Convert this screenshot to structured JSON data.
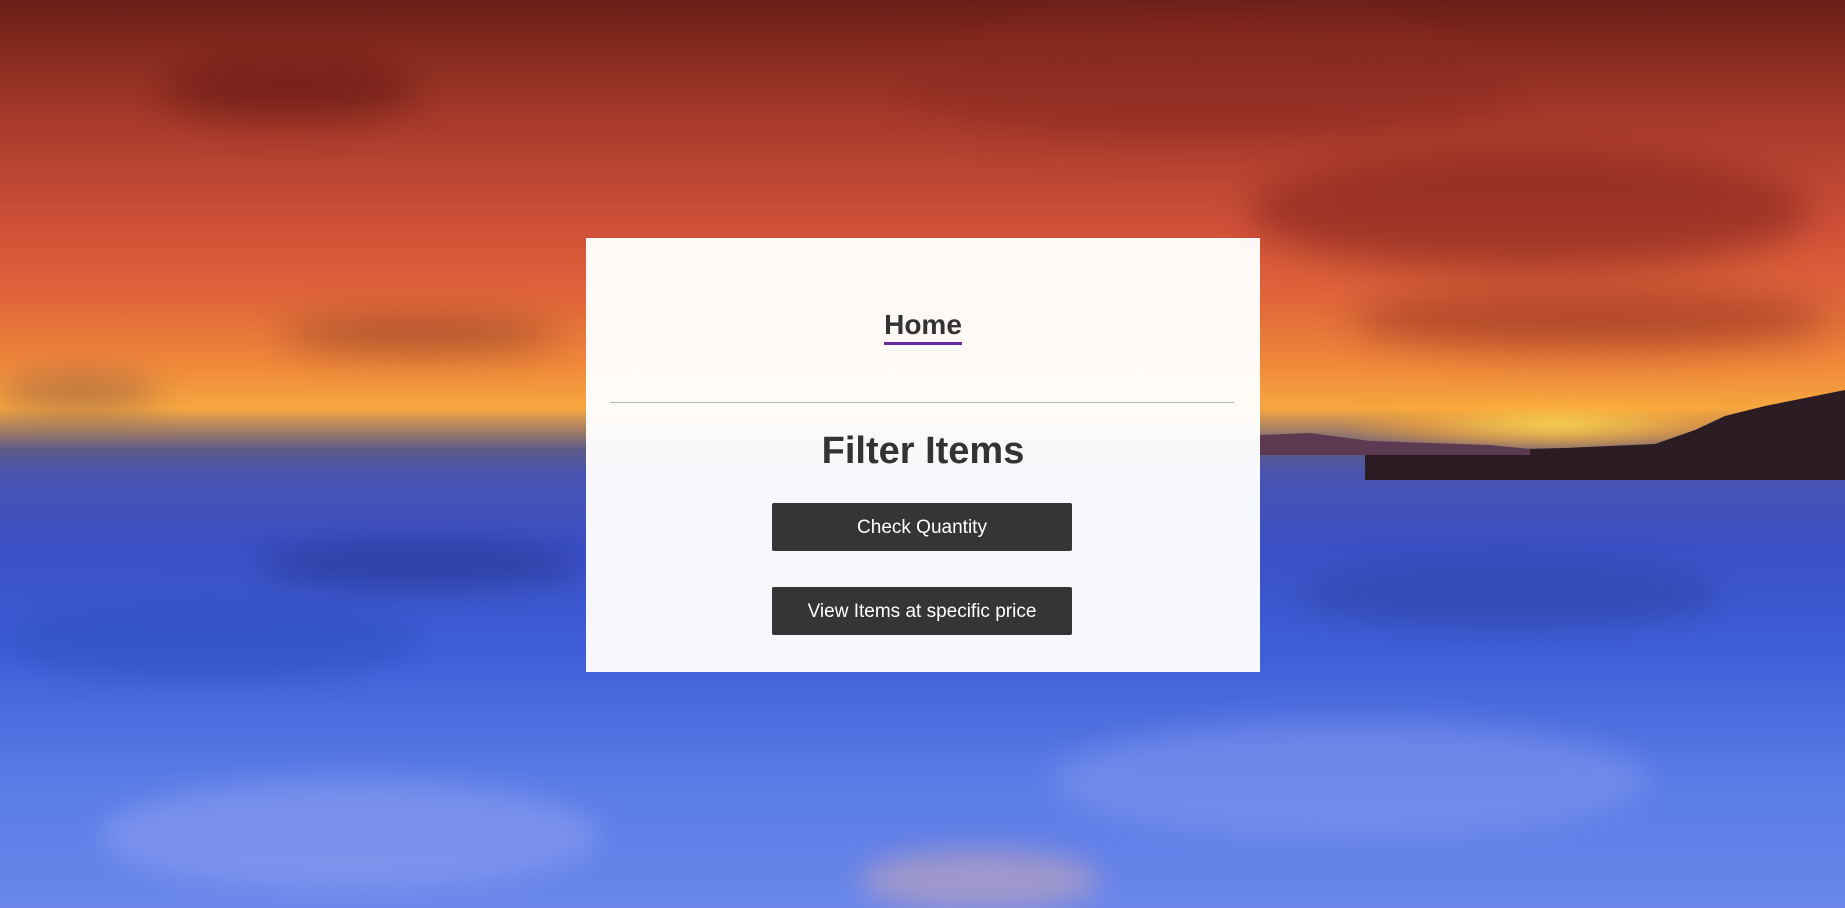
{
  "page": {
    "home_link": "Home",
    "title": "Filter Items",
    "buttons": {
      "check_quantity": "Check Quantity",
      "view_price": "View Items at specific price"
    }
  },
  "colors": {
    "button_bg": "#353535",
    "text": "#333333",
    "link_underline": "#6a2aa0"
  },
  "background": {
    "description_icon": "sunset-ocean-background"
  }
}
